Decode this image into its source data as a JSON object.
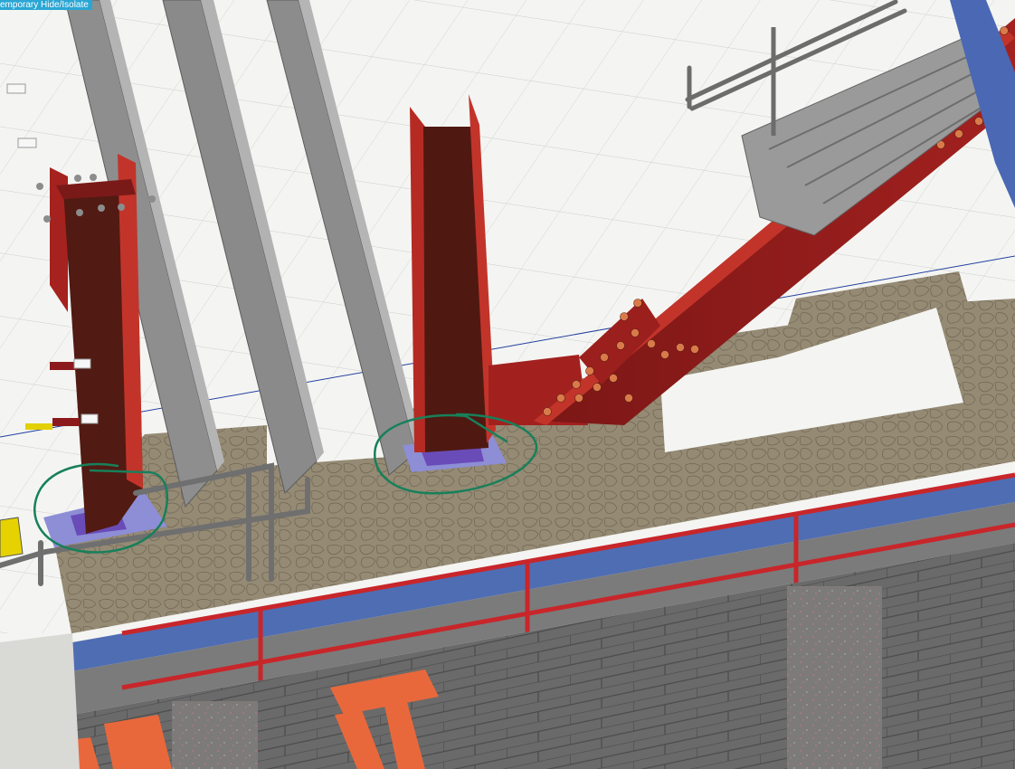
{
  "app": {
    "status_banner": "emporary Hide/Isolate"
  },
  "colors": {
    "steel": "#8c1a1c",
    "steel_dark": "#4f1912",
    "steel_edge": "#d8503a",
    "orange_steel": "#e8683c",
    "grating_gray": "#8a8a8a",
    "concrete": "#968a73",
    "blue_band": "#5a74b4",
    "masonry": "#646464",
    "markup_green": "#17805a",
    "floor": "#f4f5f2",
    "section_line": "#2440a0",
    "base_plate": "#6a4cb8"
  },
  "icons": [
    "bolt-icon",
    "markup-circle-icon"
  ],
  "tags": [
    "",
    "",
    "",
    ""
  ]
}
